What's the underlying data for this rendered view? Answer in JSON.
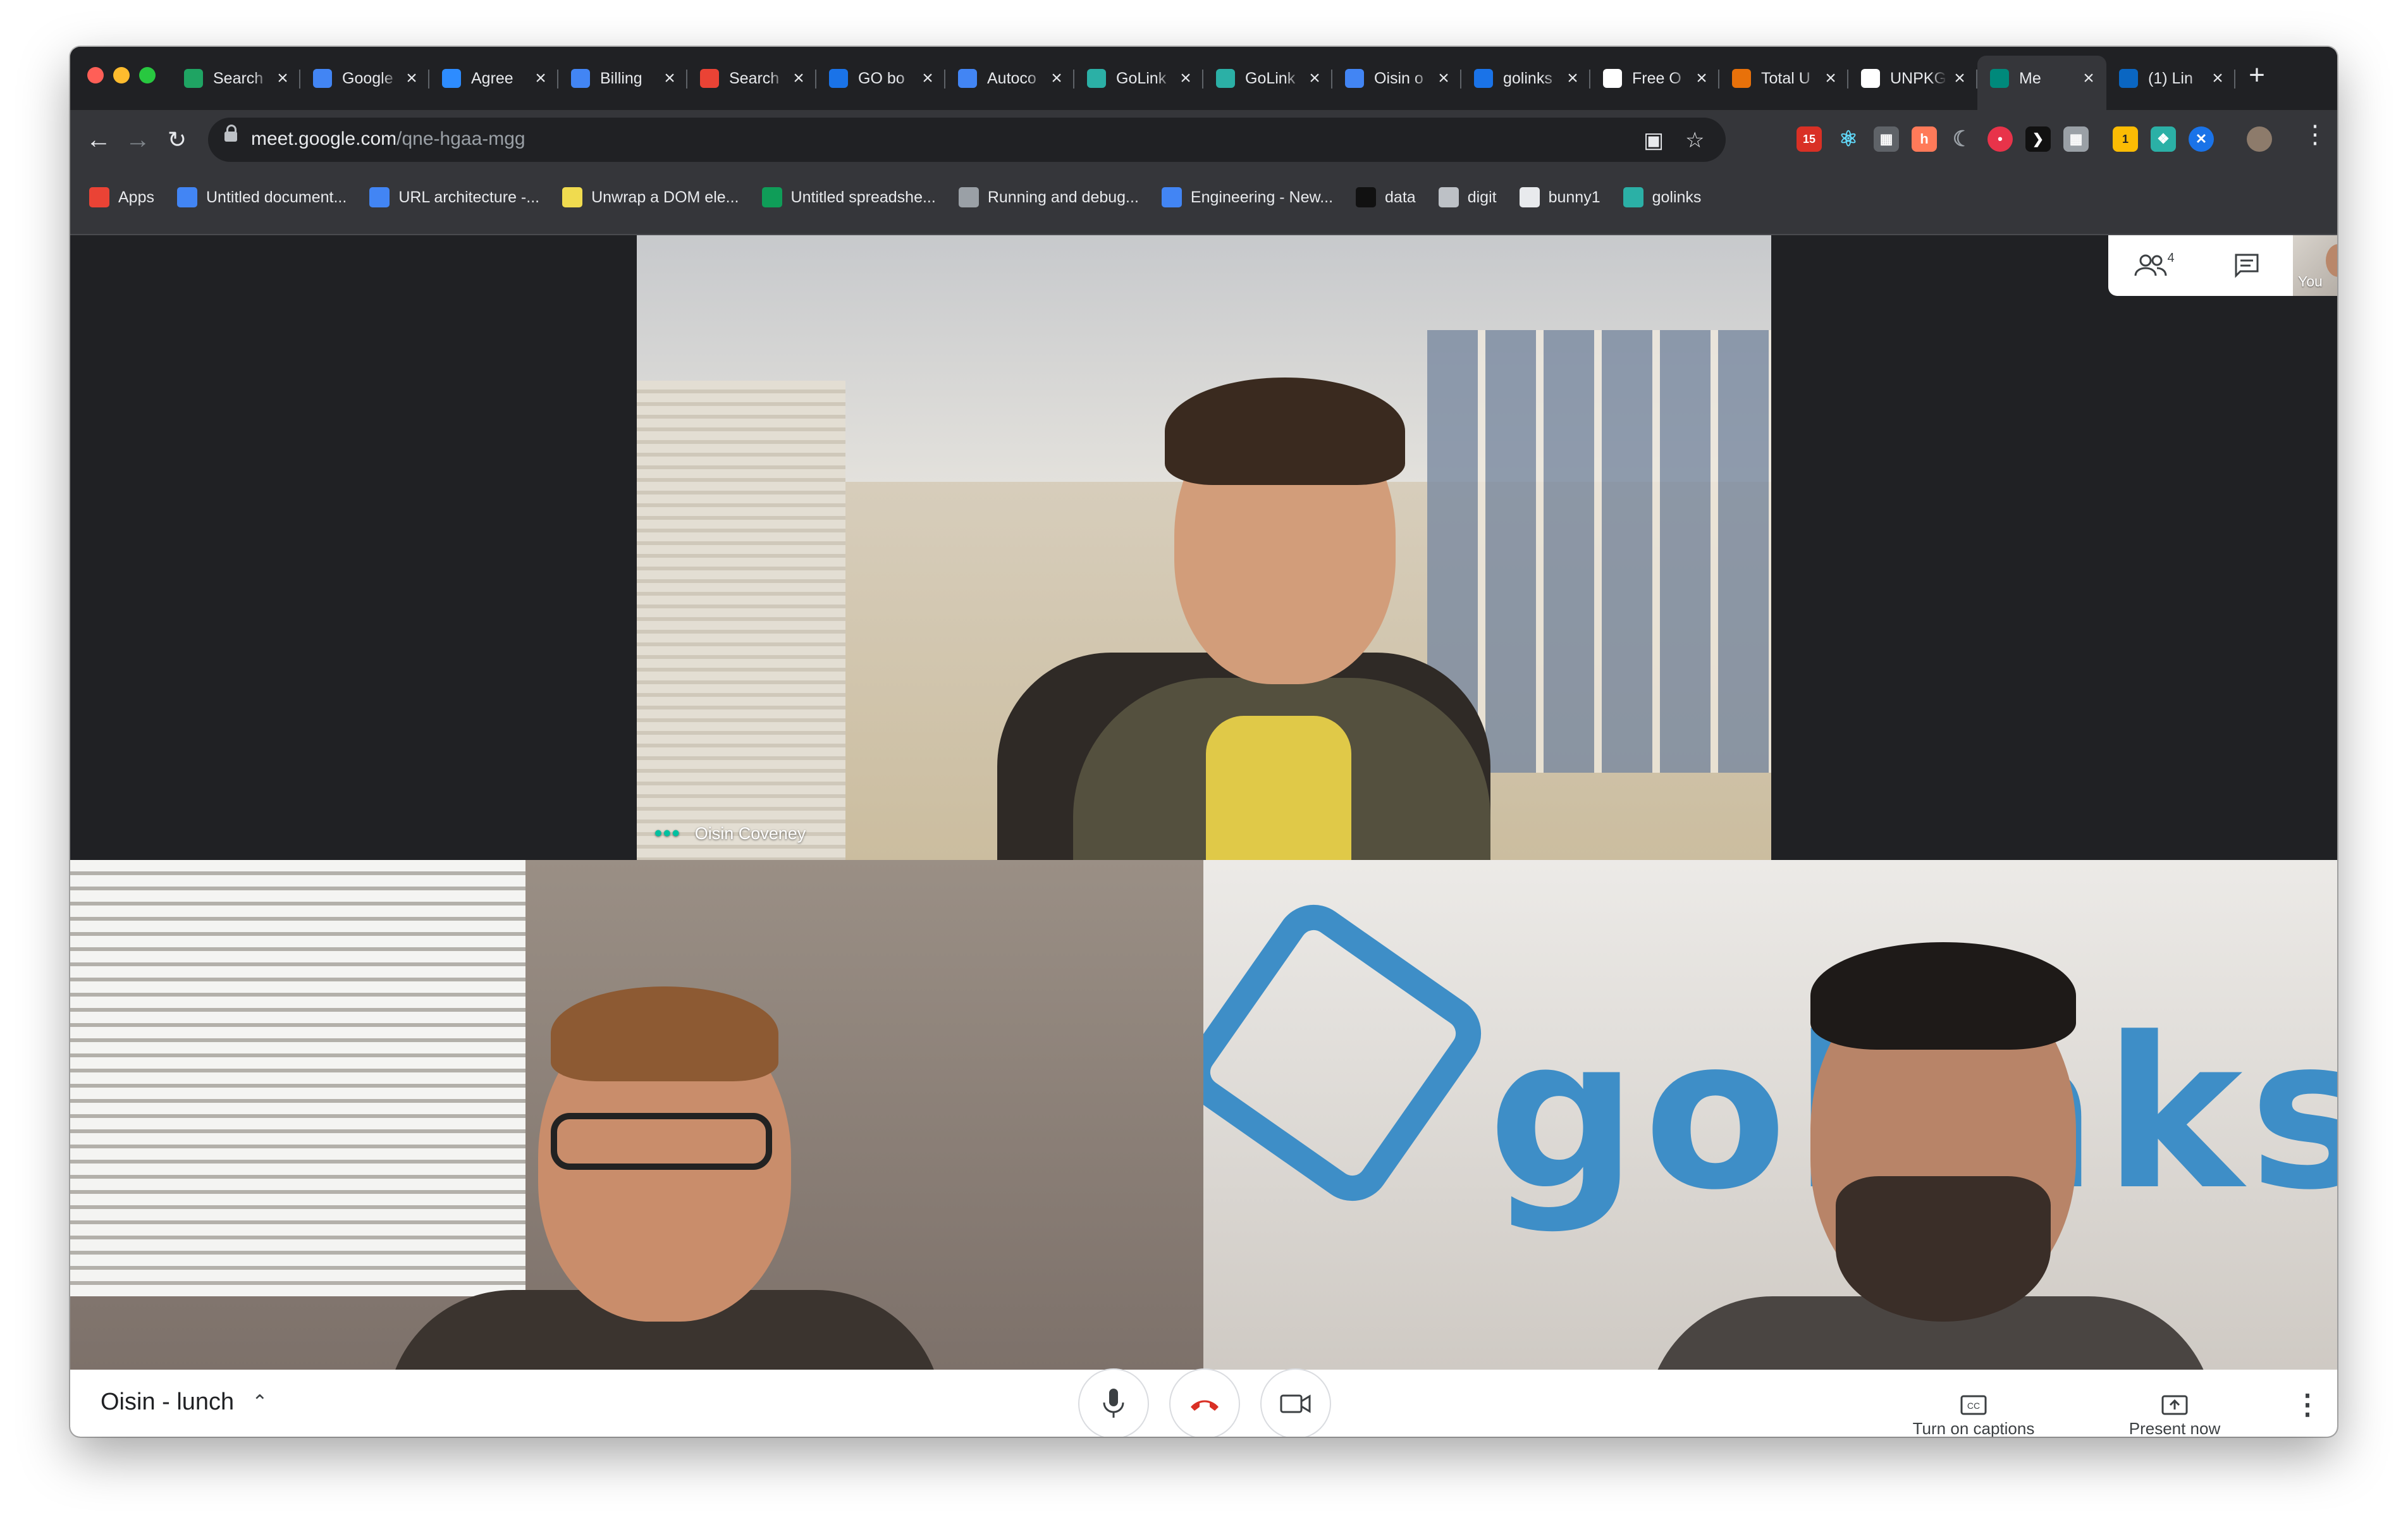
{
  "browser": {
    "tabs": [
      {
        "title": "Search",
        "favicon": "drive-icon",
        "color": "#1fa463"
      },
      {
        "title": "Google",
        "favicon": "google-icon",
        "color": "#4285f4"
      },
      {
        "title": "Agree",
        "favicon": "zoom-icon",
        "color": "#2d8cff"
      },
      {
        "title": "Billing",
        "favicon": "docs-icon",
        "color": "#4285f4"
      },
      {
        "title": "Search",
        "favicon": "gmail-icon",
        "color": "#ea4335"
      },
      {
        "title": "GO bo",
        "favicon": "diamond-icon",
        "color": "#1a73e8"
      },
      {
        "title": "Autoco",
        "favicon": "docs-icon",
        "color": "#4285f4"
      },
      {
        "title": "GoLink",
        "favicon": "golinks-icon",
        "color": "#2bb0a6"
      },
      {
        "title": "GoLink",
        "favicon": "golinks-icon",
        "color": "#2bb0a6"
      },
      {
        "title": "Oisin o",
        "favicon": "docs-icon",
        "color": "#4285f4"
      },
      {
        "title": "golinks",
        "favicon": "calendar-icon",
        "color": "#1a73e8"
      },
      {
        "title": "Free O",
        "favicon": "page-icon",
        "color": "#ffffff"
      },
      {
        "title": "Total U",
        "favicon": "dots-icon",
        "color": "#e8710a"
      },
      {
        "title": "UNPKG",
        "favicon": "unpkg-icon",
        "color": "#ffffff"
      },
      {
        "title": "Me",
        "favicon": "meet-icon",
        "color": "#00897b",
        "active": true
      },
      {
        "title": "(1) Lin",
        "favicon": "linkedin-icon",
        "color": "#0a66c2"
      }
    ],
    "url_host": "meet.google.com",
    "url_path": "/qne-hgaa-mgg",
    "extension_badge_calendar": "15",
    "extension_badge_small": "1",
    "bookmarks": [
      {
        "label": "Apps",
        "icon": "apps-grid-icon",
        "color": "#ea4335"
      },
      {
        "label": "Untitled document...",
        "icon": "docs-icon",
        "color": "#4285f4"
      },
      {
        "label": "URL architecture -...",
        "icon": "docs-icon",
        "color": "#4285f4"
      },
      {
        "label": "Unwrap a DOM ele...",
        "icon": "js-icon",
        "color": "#f0db4f"
      },
      {
        "label": "Untitled spreadshe...",
        "icon": "sheets-icon",
        "color": "#0f9d58"
      },
      {
        "label": "Running and debug...",
        "icon": "apple-icon",
        "color": "#9aa0a6"
      },
      {
        "label": "Engineering - New...",
        "icon": "docs-icon",
        "color": "#4285f4"
      },
      {
        "label": "data",
        "icon": "github-icon",
        "color": "#111111"
      },
      {
        "label": "digit",
        "icon": "digit-icon",
        "color": "#bdc1c6"
      },
      {
        "label": "bunny1",
        "icon": "globe-icon",
        "color": "#e8eaed"
      },
      {
        "label": "golinks",
        "icon": "golinks-icon",
        "color": "#2bb0a6"
      }
    ]
  },
  "meet": {
    "participant_count": "4",
    "speaker_name": "Oisin Coveney",
    "self_label": "You",
    "meeting_title": "Oisin - lunch",
    "captions_label": "Turn on captions",
    "present_label": "Present now",
    "logo_text": "golinks",
    "colors": {
      "accent_talking": "#00c0a0",
      "end_call": "#d93025"
    }
  }
}
